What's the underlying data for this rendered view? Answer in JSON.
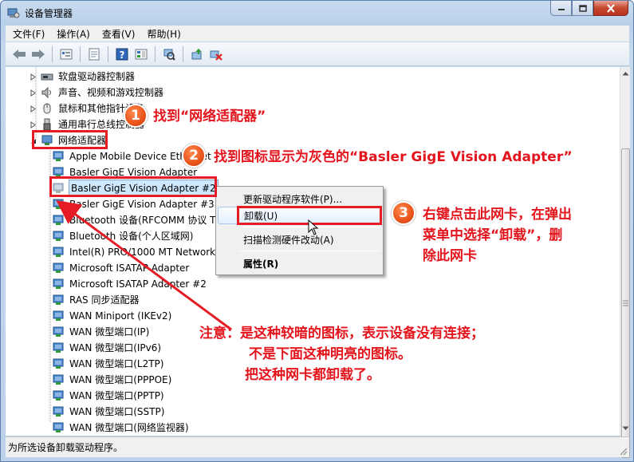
{
  "window": {
    "title": "设备管理器",
    "buttons": [
      "minimize",
      "maximize",
      "close"
    ]
  },
  "menubar": [
    {
      "label": "文件(F)"
    },
    {
      "label": "操作(A)"
    },
    {
      "label": "查看(V)"
    },
    {
      "label": "帮助(H)"
    }
  ],
  "toolbar": {
    "icons": [
      "back-arrow-icon",
      "forward-arrow-icon",
      "show-hidden-icon",
      "properties-sheet-icon",
      "help-icon",
      "view-resources-icon",
      "scan-hardware-icon",
      "update-driver-icon",
      "uninstall-icon"
    ]
  },
  "tree": {
    "categories": [
      {
        "label": "软盘驱动器控制器",
        "state": "collapsed"
      },
      {
        "label": "声音、视频和游戏控制器",
        "state": "collapsed"
      },
      {
        "label": "鼠标和其他指针设备",
        "state": "collapsed"
      },
      {
        "label": "通用串行总线控制器",
        "state": "collapsed"
      },
      {
        "label": "网络适配器",
        "state": "expanded"
      }
    ],
    "devices": [
      {
        "label": "Apple Mobile Device Ethernet",
        "dim": false
      },
      {
        "label": "Basler GigE Vision Adapter",
        "dim": false
      },
      {
        "label": "Basler GigE Vision Adapter #2",
        "dim": true,
        "selected": true
      },
      {
        "label": "Basler GigE Vision Adapter #3",
        "dim": false
      },
      {
        "label": "Bluetooth 设备(RFCOMM 协议 TDI)",
        "dim": false
      },
      {
        "label": "Bluetooth 设备(个人区域网)",
        "dim": false
      },
      {
        "label": "Intel(R) PRO/1000 MT Network Connection",
        "dim": false
      },
      {
        "label": "Microsoft ISATAP Adapter",
        "dim": false
      },
      {
        "label": "Microsoft ISATAP Adapter #2",
        "dim": false
      },
      {
        "label": "RAS 同步适配器",
        "dim": false
      },
      {
        "label": "WAN Miniport (IKEv2)",
        "dim": false
      },
      {
        "label": "WAN 微型端口(IP)",
        "dim": false
      },
      {
        "label": "WAN 微型端口(IPv6)",
        "dim": false
      },
      {
        "label": "WAN 微型端口(L2TP)",
        "dim": false
      },
      {
        "label": "WAN 微型端口(PPPOE)",
        "dim": false
      },
      {
        "label": "WAN 微型端口(PPTP)",
        "dim": false
      },
      {
        "label": "WAN 微型端口(SSTP)",
        "dim": false
      },
      {
        "label": "WAN 微型端口(网络监视器)",
        "dim": false
      }
    ]
  },
  "context_menu": {
    "items": [
      {
        "label": "更新驱动程序软件(P)...",
        "highlighted": false,
        "bold": false
      },
      {
        "label": "卸载(U)",
        "highlighted": true,
        "bold": false
      },
      {
        "label": "扫描检测硬件改动(A)",
        "highlighted": false,
        "bold": false
      },
      {
        "label": "属性(R)",
        "highlighted": false,
        "bold": true
      }
    ]
  },
  "status": {
    "text": "为所选设备卸载驱动程序。"
  },
  "annotations": {
    "step1": {
      "number": "1",
      "text": "找到“网络适配器”"
    },
    "step2": {
      "number": "2",
      "text": "找到图标显示为灰色的“Basler GigE Vision Adapter”"
    },
    "step3": {
      "number": "3",
      "lines": [
        "右键点击此网卡，在弹出",
        "菜单中选择“卸载”，删",
        "除此网卡"
      ]
    },
    "note": {
      "lines": [
        "注意：是这种较暗的图标，表示设备没有连接；",
        "不是下面这种明亮的图标。",
        "把这种网卡都卸载了。"
      ]
    }
  },
  "colors": {
    "annotation_red": "#e3141c",
    "badge_orange": "#e8531a",
    "selection": "#cde8ff"
  }
}
